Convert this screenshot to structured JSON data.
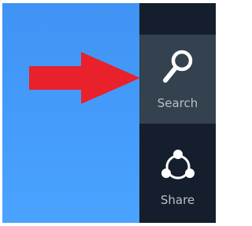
{
  "charms": {
    "items": [
      {
        "label": "Search",
        "icon": "search-icon",
        "state": "highlighted"
      },
      {
        "label": "Share",
        "icon": "share-icon"
      }
    ]
  },
  "annotation": {
    "icon": "red-arrow-icon",
    "color": "#e8212a"
  },
  "colors": {
    "charm_bar": "#141e2c",
    "charm_highlight": "#34414e",
    "desktop": "#4aa3ff"
  }
}
